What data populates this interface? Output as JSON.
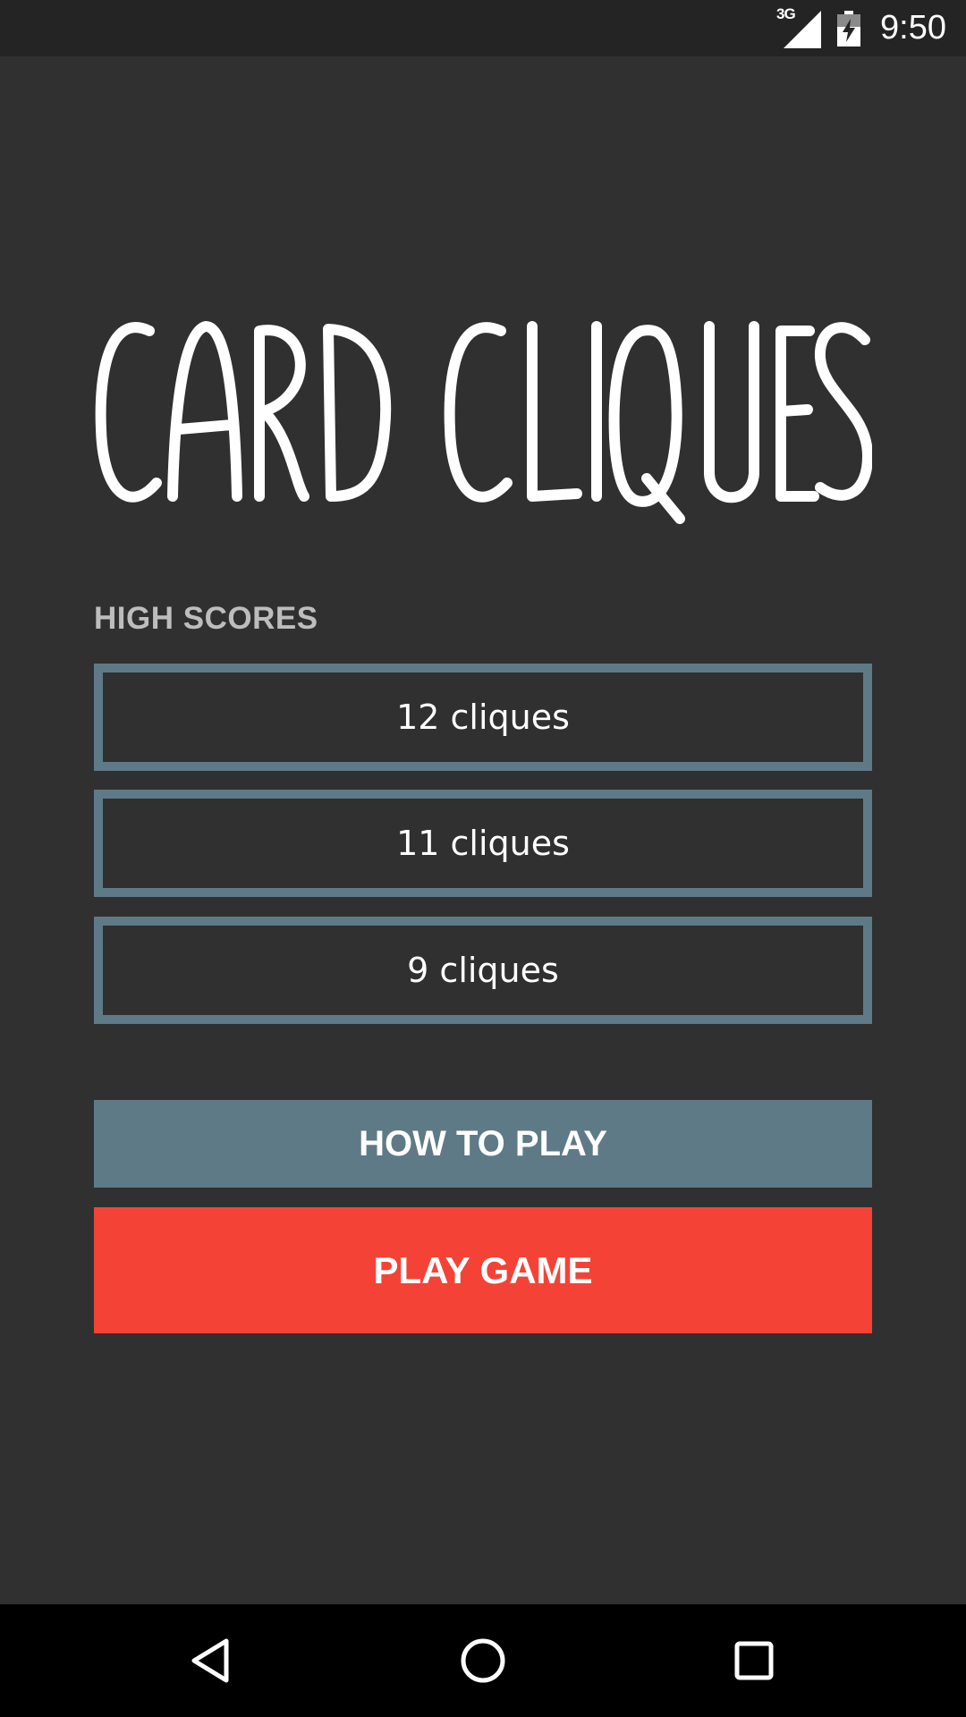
{
  "status_bar": {
    "network_label": "3G",
    "time": "9:50",
    "icons": [
      "signal-icon",
      "battery-charging-icon"
    ]
  },
  "app": {
    "title": "CARD CLIQUES"
  },
  "high_scores": {
    "label": "HIGH SCORES",
    "entries": [
      "12 cliques",
      "11 cliques",
      "9 cliques"
    ]
  },
  "buttons": {
    "how_to_play": "HOW TO PLAY",
    "play_game": "PLAY GAME"
  },
  "nav_bar": {
    "icons": [
      "back-icon",
      "home-icon",
      "recents-icon"
    ]
  },
  "colors": {
    "background": "#303030",
    "accent_slate": "#5f7a87",
    "accent_red": "#f44336",
    "label_gray": "#bdbdbd"
  }
}
